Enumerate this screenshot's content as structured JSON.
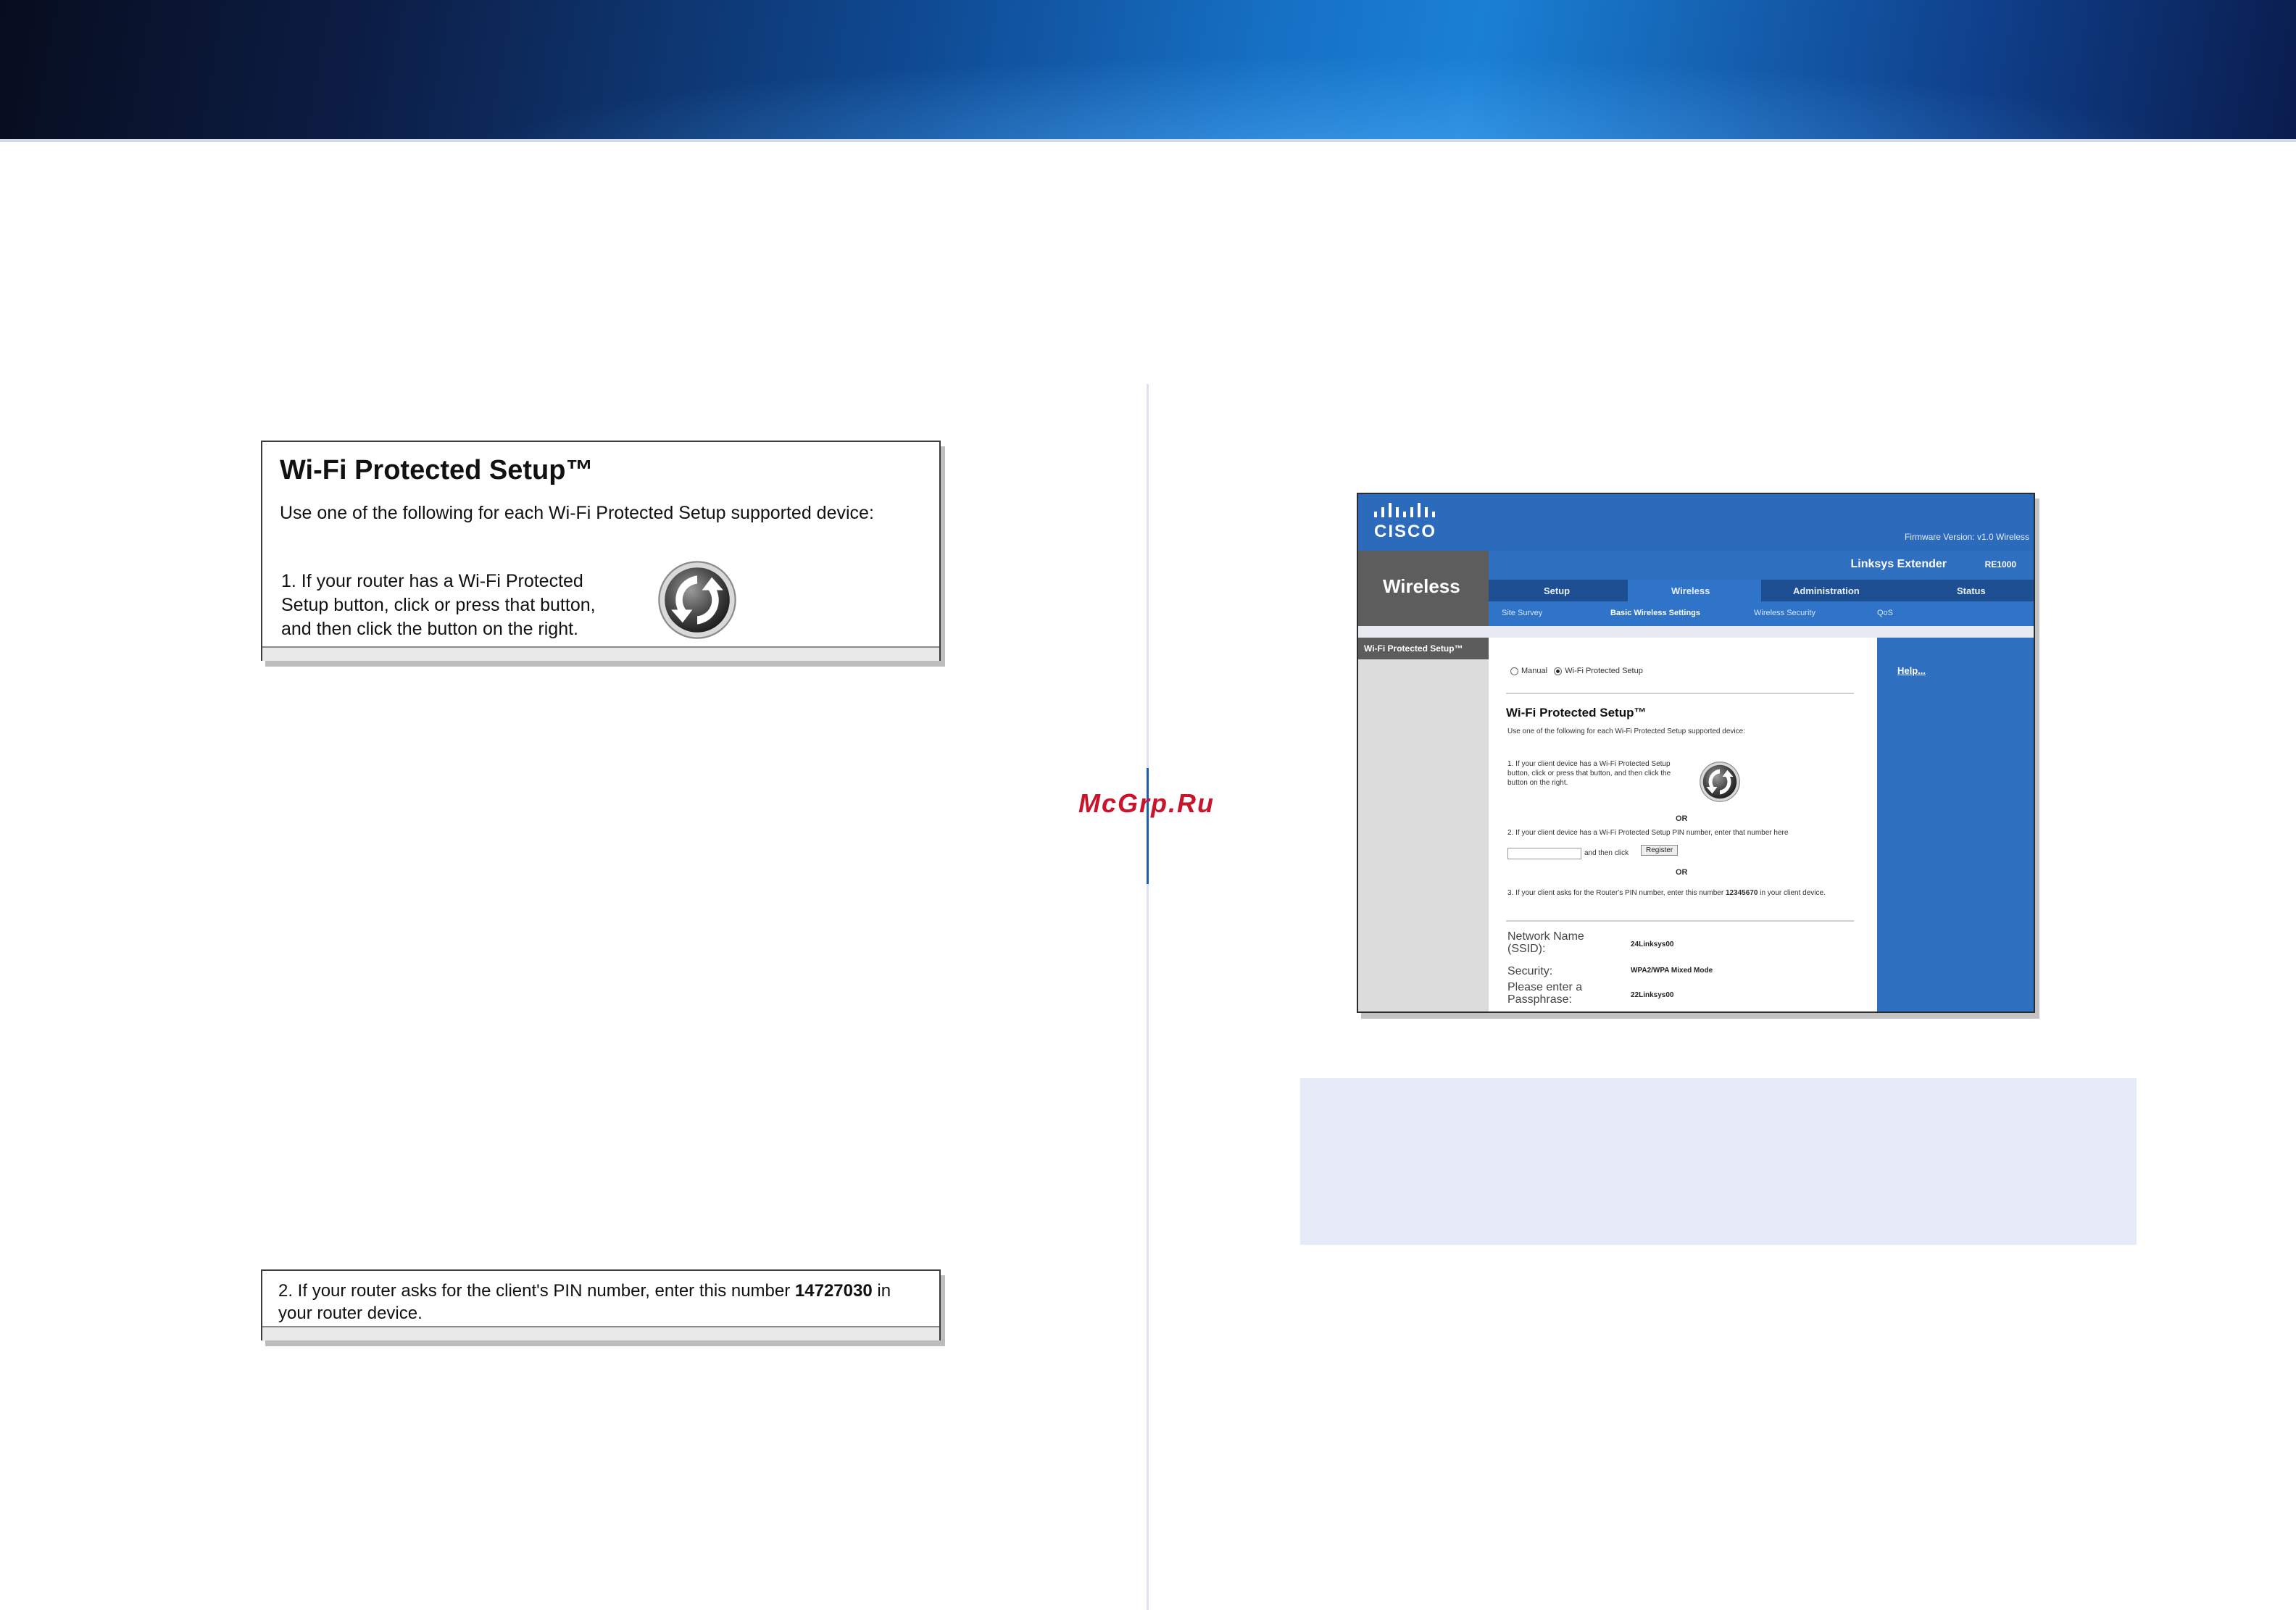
{
  "watermark": "McGrp.Ru",
  "wps_box": {
    "title": "Wi-Fi Protected Setup™",
    "subtitle": "Use one of the following for each Wi-Fi Protected Setup supported device:",
    "step1": "1. If your router has a Wi-Fi Protected Setup button, click or press that button, and then click the button on the right.",
    "icon": "wps-icon"
  },
  "pin_box": {
    "text_before": "2. If your router asks for the client's PIN number, enter this number ",
    "pin": "14727030",
    "text_after": " in your router device."
  },
  "router_shot": {
    "logo": "CISCO",
    "firmware": "Firmware Version: v1.0 Wireless",
    "area": "Wireless",
    "model_name": "Linksys Extender",
    "model_code": "RE1000",
    "tabs": [
      "Setup",
      "Wireless",
      "Administration",
      "Status"
    ],
    "subtabs": [
      "Site Survey",
      "Basic Wireless Settings",
      "Wireless Security",
      "QoS"
    ],
    "side_item": "Wi-Fi Protected Setup™",
    "help": "Help...",
    "radio_manual": "Manual",
    "radio_wps": "Wi-Fi Protected Setup",
    "wps_title": "Wi-Fi Protected Setup™",
    "wps_subtitle": "Use one of the following for each Wi-Fi Protected Setup supported device:",
    "step1": "1. If your client device has a Wi-Fi Protected Setup button, click or press that button, and then click the button on the right.",
    "or": "OR",
    "step2": "2. If your client device has a Wi-Fi Protected Setup PIN number, enter that number here",
    "step2b": "and then click",
    "register": "Register",
    "step3_before": "3. If your client asks for the Router's PIN number, enter this number ",
    "step3_pin": "12345670",
    "step3_after": " in your client device.",
    "fields": [
      {
        "label": "Network Name (SSID):",
        "value": "24Linksys00"
      },
      {
        "label": "Security:",
        "value": "WPA2/WPA Mixed Mode"
      },
      {
        "label": "Please enter a Passphrase:",
        "value": "22Linksys00"
      }
    ]
  },
  "colors": {
    "banner_blue": "#1670c4",
    "cisco_blue": "#2e6fc0",
    "note_panel": "#e6ebf7",
    "watermark_red": "#c8142c"
  }
}
